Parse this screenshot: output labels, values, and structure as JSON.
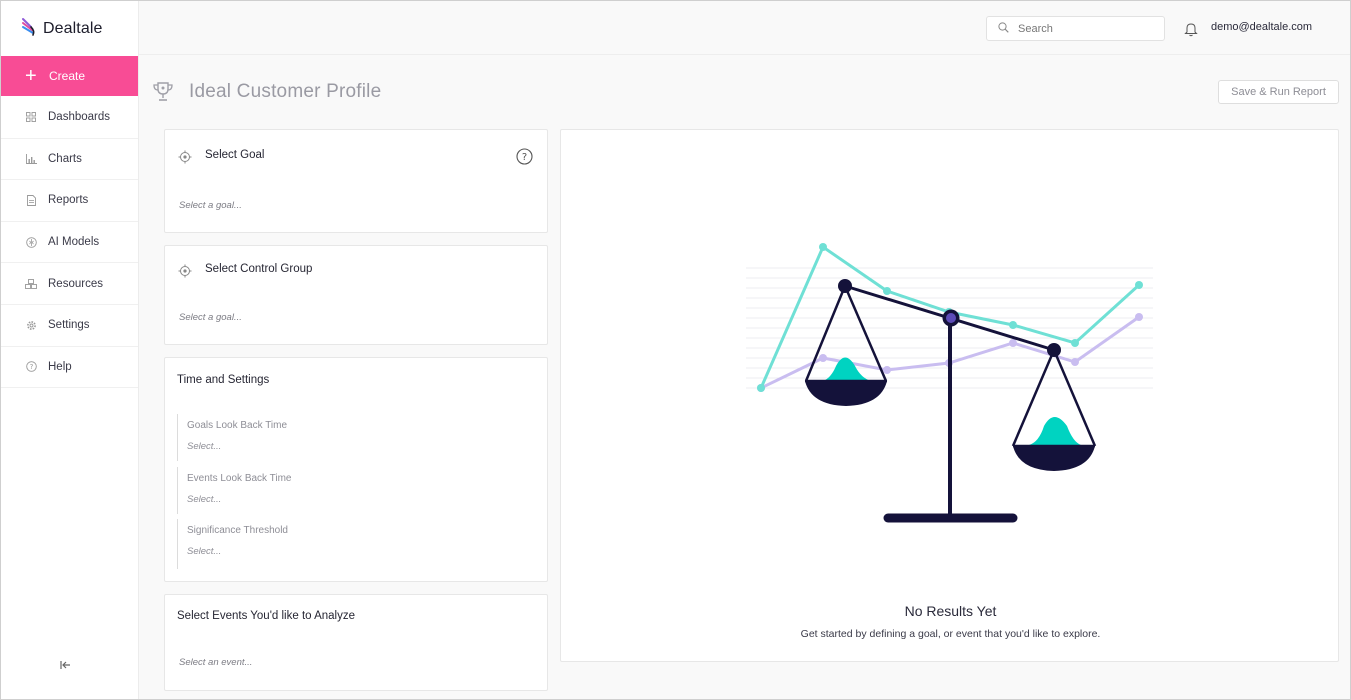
{
  "app": {
    "brand": "Dealtale"
  },
  "sidebar": {
    "create_label": "Create",
    "items": [
      {
        "label": "Dashboards",
        "icon": "dashboard-icon"
      },
      {
        "label": "Charts",
        "icon": "chart-icon"
      },
      {
        "label": "Reports",
        "icon": "report-icon"
      },
      {
        "label": "AI Models",
        "icon": "ai-icon"
      },
      {
        "label": "Resources",
        "icon": "resources-icon"
      },
      {
        "label": "Settings",
        "icon": "gear-icon"
      },
      {
        "label": "Help",
        "icon": "help-icon"
      }
    ]
  },
  "topbar": {
    "search_placeholder": "Search",
    "user_email": "demo@dealtale.com"
  },
  "page": {
    "title": "Ideal Customer Profile",
    "run_button": "Save & Run Report"
  },
  "cards": {
    "goal": {
      "title": "Select Goal",
      "placeholder": "Select a goal..."
    },
    "control": {
      "title": "Select Control Group",
      "placeholder": "Select a goal..."
    },
    "time": {
      "title": "Time and Settings",
      "settings": [
        {
          "label": "Goals Look Back Time",
          "value": "Select..."
        },
        {
          "label": "Events Look Back Time",
          "value": "Select..."
        },
        {
          "label": "Significance Threshold",
          "value": "Select..."
        }
      ]
    },
    "events": {
      "title": "Select Events You'd like to Analyze",
      "placeholder": "Select an event..."
    }
  },
  "results": {
    "title": "No Results Yet",
    "subtitle": "Get started by defining a goal, or event that you'd like to explore."
  },
  "colors": {
    "accent": "#f84c95",
    "teal": "#00d3c1",
    "lavender": "#c9bdf0",
    "navy": "#14123a"
  }
}
